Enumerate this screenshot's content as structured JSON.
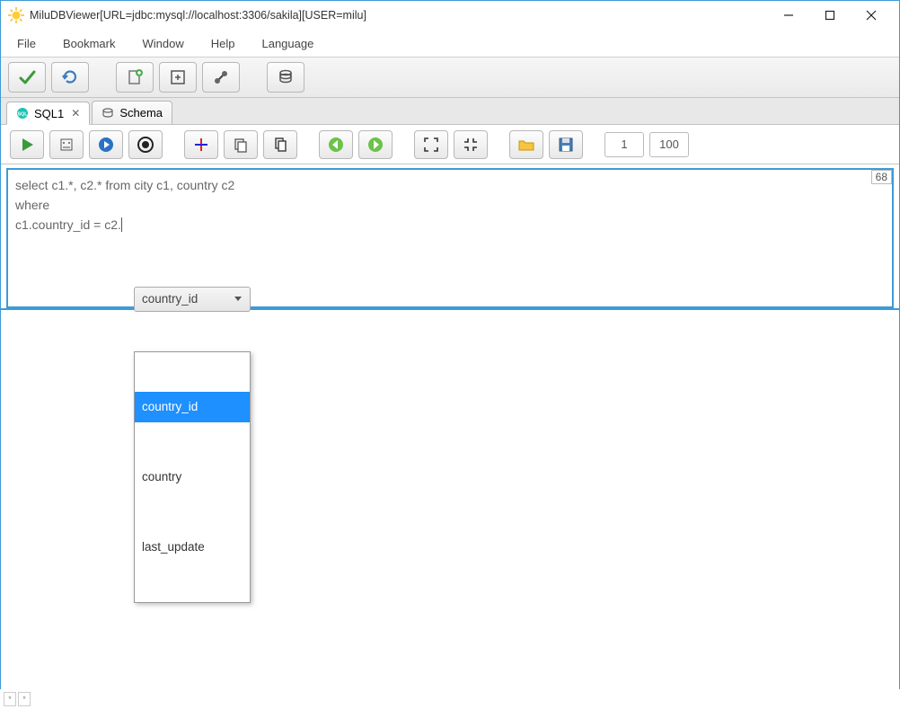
{
  "window": {
    "title": "MiluDBViewer[URL=jdbc:mysql://localhost:3306/sakila][USER=milu]"
  },
  "menu": {
    "file": "File",
    "bookmark": "Bookmark",
    "window": "Window",
    "help": "Help",
    "language": "Language"
  },
  "tabs": {
    "sql1": "SQL1",
    "schema": "Schema"
  },
  "editor": {
    "line1": "select c1.*, c2.* from city c1, country c2",
    "line2": "where",
    "line3": "c1.country_id = c2.",
    "char_count": "68"
  },
  "autocomplete": {
    "selected": "country_id",
    "opt0": "country_id",
    "opt1": "country",
    "opt2": "last_update"
  },
  "pager": {
    "from": "1",
    "to": "100"
  },
  "status": {
    "a": "*",
    "b": "*"
  }
}
